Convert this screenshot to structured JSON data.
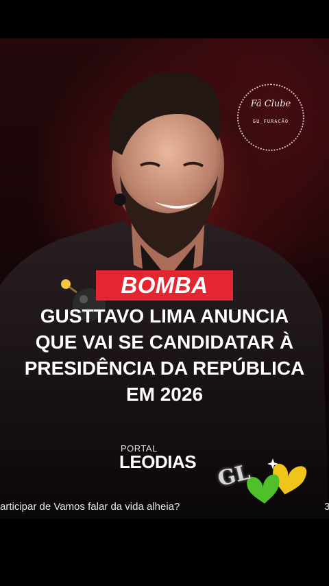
{
  "fan_logo": {
    "title": "Fã Clube",
    "handle": "GU_FURACÃO"
  },
  "badge": "BOMBA",
  "headline": [
    "GUSTTAVO LIMA ANUNCIA",
    "QUE VAI SE CANDIDATAR À",
    "PRESIDÊNCIA DA REPÚBLICA",
    "EM 2026"
  ],
  "portal": {
    "small": "PORTAL",
    "name": "LEODIAS"
  },
  "sticker_text": "GL",
  "caption": "articipar de Vamos falar da vida alheia?",
  "caption_trailing": "3",
  "colors": {
    "badge": "#e3262f",
    "heart_green": "#4fbf2a",
    "heart_yellow": "#f0c419"
  }
}
